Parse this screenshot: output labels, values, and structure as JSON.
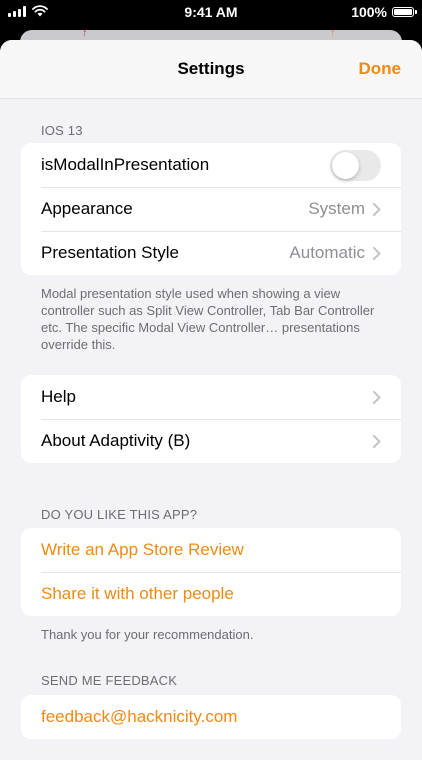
{
  "status_bar": {
    "time": "9:41 AM",
    "battery": "100%",
    "icons": [
      "signal-icon",
      "wifi-icon",
      "battery-icon"
    ]
  },
  "colors": {
    "accent": "#ef8a14",
    "background": "#f2f2f7",
    "secondary_text": "#8e8e93",
    "footer_text": "#6d6d72"
  },
  "nav": {
    "title": "Settings",
    "done": "Done"
  },
  "section_ios13": {
    "header": "IOS 13",
    "rows": [
      {
        "label": "isModalInPresentation",
        "toggle_on": false
      },
      {
        "label": "Appearance",
        "value": "System"
      },
      {
        "label": "Presentation Style",
        "value": "Automatic"
      }
    ],
    "footer": "Modal presentation style used when showing a view controller such as Split View Controller, Tab Bar Controller etc. The specific Modal View Controller… presentations override this."
  },
  "section_help": {
    "rows": [
      {
        "label": "Help"
      },
      {
        "label": "About Adaptivity (B)"
      }
    ]
  },
  "section_like": {
    "header": "DO YOU LIKE THIS APP?",
    "rows": [
      {
        "label": "Write an App Store Review"
      },
      {
        "label": "Share it with other people"
      }
    ],
    "footer": "Thank you for your recommendation."
  },
  "section_feedback": {
    "header": "SEND ME FEEDBACK",
    "rows": [
      {
        "label": "feedback@hacknicity.com"
      }
    ]
  }
}
